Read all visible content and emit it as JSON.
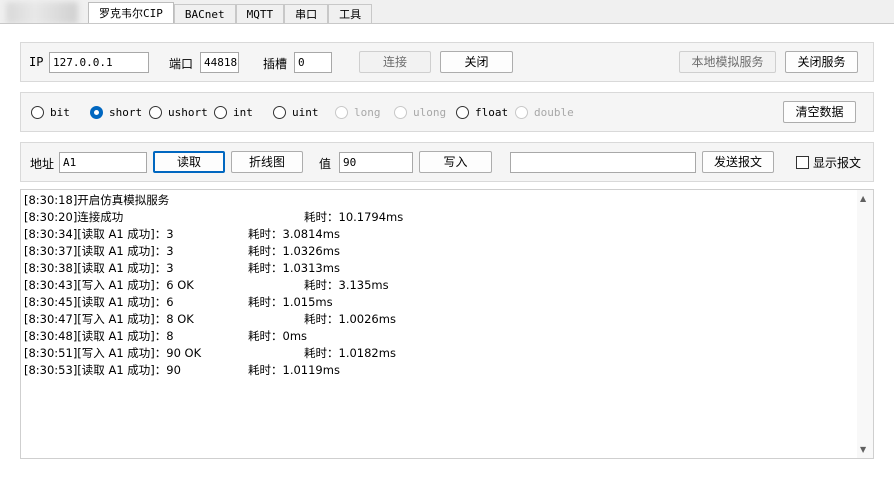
{
  "tabs": [
    {
      "label": "罗克韦尔CIP",
      "active": true
    },
    {
      "label": "BACnet",
      "active": false
    },
    {
      "label": "MQTT",
      "active": false
    },
    {
      "label": "串口",
      "active": false
    },
    {
      "label": "工具",
      "active": false
    }
  ],
  "connection": {
    "ip_label": "IP",
    "ip_value": "127.0.0.1",
    "port_label": "端口",
    "port_value": "44818",
    "slot_label": "插槽",
    "slot_value": "0",
    "connect_label": "连接",
    "close_label": "关闭",
    "local_sim_label": "本地模拟服务",
    "close_service_label": "关闭服务"
  },
  "types": {
    "options": [
      {
        "label": "bit",
        "checked": false,
        "enabled": true
      },
      {
        "label": "short",
        "checked": true,
        "enabled": true
      },
      {
        "label": "ushort",
        "checked": false,
        "enabled": true
      },
      {
        "label": "int",
        "checked": false,
        "enabled": true
      },
      {
        "label": "uint",
        "checked": false,
        "enabled": true
      },
      {
        "label": "long",
        "checked": false,
        "enabled": false
      },
      {
        "label": "ulong",
        "checked": false,
        "enabled": false
      },
      {
        "label": "float",
        "checked": false,
        "enabled": true
      },
      {
        "label": "double",
        "checked": false,
        "enabled": false
      }
    ],
    "clear_label": "清空数据"
  },
  "operation": {
    "address_label": "地址",
    "address_value": "A1",
    "read_label": "读取",
    "chart_label": "折线图",
    "value_label": "值",
    "value_value": "90",
    "write_label": "写入",
    "message_value": "",
    "send_label": "发送报文",
    "show_message_label": "显示报文",
    "show_message_checked": false
  },
  "log": [
    {
      "time": "[8:30:18]",
      "text": "开启仿真模拟服务",
      "cost": ""
    },
    {
      "time": "[8:30:20]",
      "text": "连接成功",
      "cost": "耗时：10.1794ms"
    },
    {
      "time": "[8:30:34]",
      "text": "[读取 A1 成功]：3",
      "cost": "耗时：3.0814ms"
    },
    {
      "time": "[8:30:37]",
      "text": "[读取 A1 成功]：3",
      "cost": "耗时：1.0326ms"
    },
    {
      "time": "[8:30:38]",
      "text": "[读取 A1 成功]：3",
      "cost": "耗时：1.0313ms"
    },
    {
      "time": "[8:30:43]",
      "text": "[写入 A1 成功]：6 OK",
      "cost": "耗时：3.135ms"
    },
    {
      "time": "[8:30:45]",
      "text": "[读取 A1 成功]：6",
      "cost": "耗时：1.015ms"
    },
    {
      "time": "[8:30:47]",
      "text": "[写入 A1 成功]：8 OK",
      "cost": "耗时：1.0026ms"
    },
    {
      "time": "[8:30:48]",
      "text": "[读取 A1 成功]：8",
      "cost": "耗时：0ms"
    },
    {
      "time": "[8:30:51]",
      "text": "[写入 A1 成功]：90 OK",
      "cost": "耗时：1.0182ms"
    },
    {
      "time": "[8:30:53]",
      "text": "[读取 A1 成功]：90",
      "cost": "耗时：1.0119ms"
    }
  ],
  "icons": {
    "scroll_up": "scroll-up-arrow-icon",
    "scroll_down": "scroll-down-arrow-icon",
    "radio": "radio-button-icon",
    "checkbox": "checkbox-icon"
  },
  "colors": {
    "accent": "#0067c0",
    "panel_bg": "#f5f5f5",
    "page_bg": "#ffffff"
  }
}
